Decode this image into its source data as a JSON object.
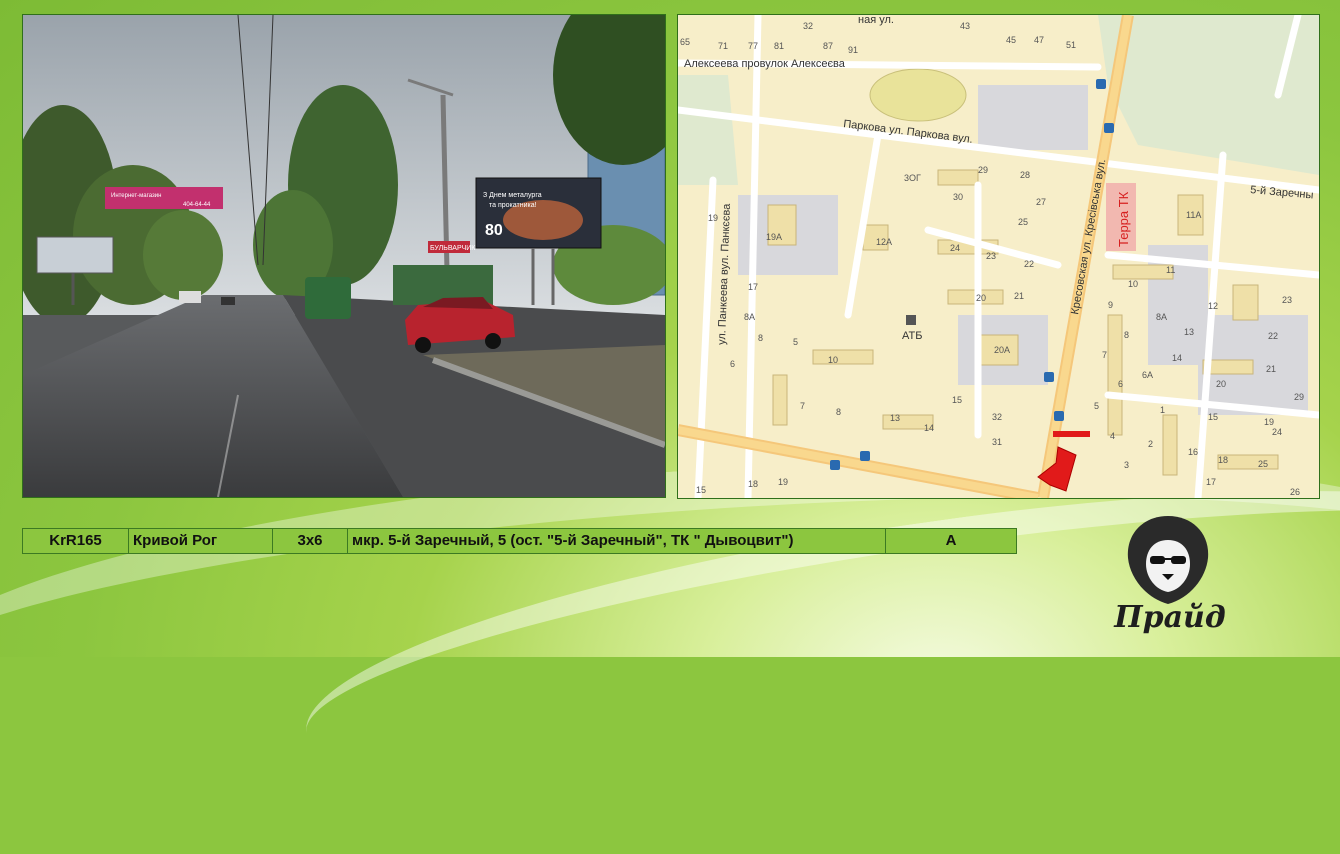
{
  "photo": {
    "billboard_left": {
      "line1": "Интернет-магазин",
      "line2": "404-64-44"
    },
    "billboard_right": {
      "line1": "З Днем металурга",
      "line2": "та прокатника!",
      "big": "80"
    },
    "shop_sign": "БУЛЬВАРЧИК"
  },
  "map": {
    "streets": {
      "alekseeva": "Алексеева провулок Алексеєва",
      "parkovaya": "Паркова ул. Паркова вул.",
      "pankeeva": "ул. Панкеева вул. Панкєєва",
      "kresovskaya": "Кресовская ул. Кресівська вул.",
      "zarechny": "5-й Заречны",
      "top": "ная ул."
    },
    "poi": {
      "terra": "Терра ТК",
      "atb": "АТБ"
    },
    "house_numbers": [
      "32",
      "43",
      "45",
      "47",
      "51",
      "65",
      "71",
      "77",
      "81",
      "87",
      "91",
      "3ОГ",
      "29",
      "28",
      "30",
      "27",
      "25",
      "24",
      "23",
      "22",
      "20",
      "21",
      "19",
      "19А",
      "12А",
      "17",
      "8А",
      "8",
      "5",
      "6",
      "10",
      "7",
      "8",
      "13",
      "14",
      "15",
      "20А",
      "32",
      "31",
      "4",
      "2",
      "6",
      "11",
      "10",
      "9",
      "8А",
      "8",
      "7",
      "6",
      "5",
      "4",
      "3",
      "2",
      "1",
      "6А",
      "12",
      "13",
      "14",
      "15",
      "16",
      "17",
      "18",
      "19",
      "20",
      "21",
      "22",
      "23",
      "24",
      "25",
      "26",
      "29",
      "11А",
      "15",
      "18",
      "19"
    ]
  },
  "info": {
    "code": "KrR165",
    "city": "Кривой Рог",
    "size": "3x6",
    "address": "мкр. 5-й Заречный, 5 (ост. \"5-й Заречный\", ТК \" Дывоцвит\")",
    "side": "А"
  },
  "brand": {
    "name": "Прайд"
  }
}
